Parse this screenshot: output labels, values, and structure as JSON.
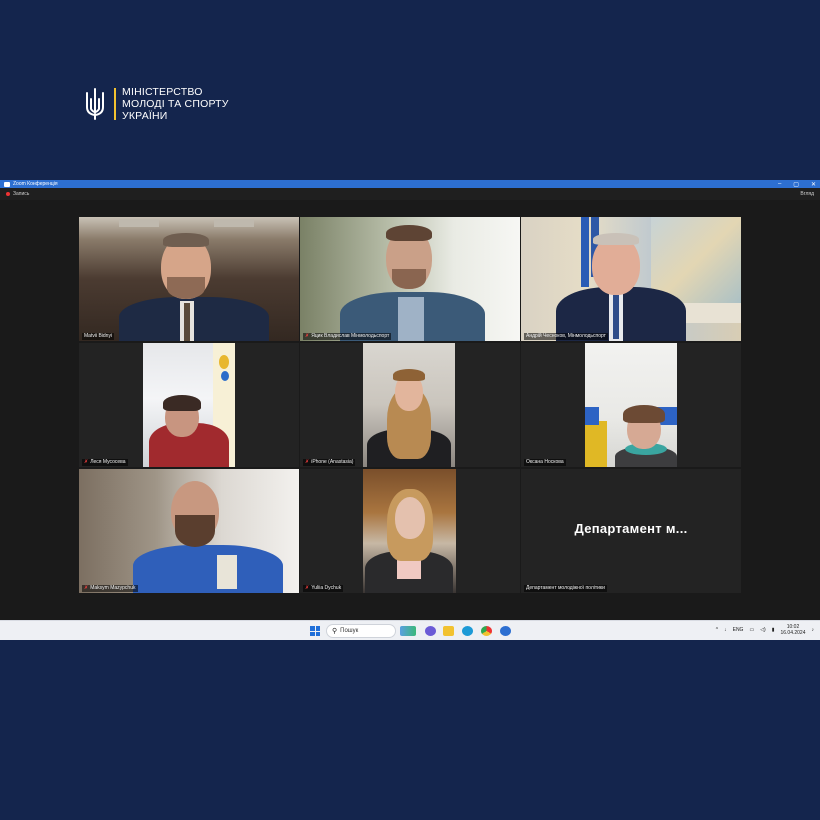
{
  "logo": {
    "line1": "МІНІСТЕРСТВО",
    "line2": "МОЛОДІ ТА СПОРТУ",
    "line3": "УКРАЇНИ"
  },
  "window": {
    "title": "Zoom Конференція",
    "minimize": "–",
    "maximize": "▢",
    "close": "✕"
  },
  "toolbar": {
    "record_label": "Запись",
    "view_label": "Вгляд"
  },
  "participants": [
    {
      "name": "Matvii Bidnyi",
      "muted": false,
      "active": true
    },
    {
      "name": "Яцик Владислав Мінмолодьспорт",
      "muted": true,
      "active": false
    },
    {
      "name": "Андрій Чесноков, Мінмолодьспорт",
      "muted": false,
      "active": false
    },
    {
      "name": "Леся Мусосева",
      "muted": true,
      "active": false
    },
    {
      "name": "iPhone (Anastasia)",
      "muted": true,
      "active": false
    },
    {
      "name": "Оксана Носкова",
      "muted": false,
      "active": false
    },
    {
      "name": "Maksym Mazyрchuk",
      "muted": true,
      "active": false
    },
    {
      "name": "Yuliia Dychuk",
      "muted": true,
      "active": false
    },
    {
      "name": "Департамент молодіжної політики",
      "muted": false,
      "active": false
    }
  ],
  "dept_tile_text": "Департамент м...",
  "taskbar": {
    "search_placeholder": "Пошук",
    "language": "ENG",
    "time": "10:02",
    "date": "16.04.2024"
  },
  "colors": {
    "background": "#14254d",
    "accent_yellow": "#f2c230",
    "zoom_blue": "#2d6fd1",
    "active_speaker": "#b5d65a"
  }
}
